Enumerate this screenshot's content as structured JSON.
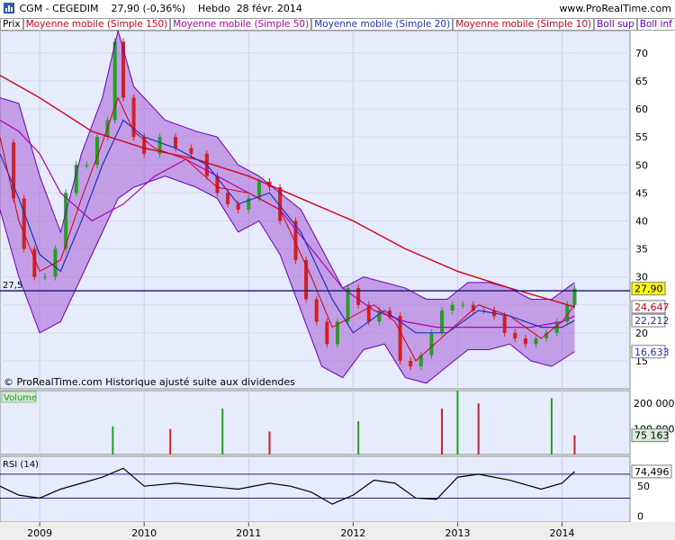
{
  "header": {
    "symbol_title": "CGM - CEGEDIM",
    "price_info": "27,90 (-0,36%)",
    "timeframe": "Hebdo",
    "date": "28 févr. 2014",
    "website": "www.ProRealTime.com"
  },
  "legend": [
    {
      "label": "Prix",
      "color": "#000000"
    },
    {
      "label": "Moyenne mobile (Simple 150)",
      "color": "#d0021b"
    },
    {
      "label": "Moyenne mobile (Simple 50)",
      "color": "#b000b0"
    },
    {
      "label": "Moyenne mobile (Simple 20)",
      "color": "#2030c0"
    },
    {
      "label": "Moyenne mobile (Simple 10)",
      "color": "#d0021b"
    },
    {
      "label": "Boll sup",
      "color": "#6a00c0"
    },
    {
      "label": "Boll inf (20 2)",
      "color": "#6a00c0"
    }
  ],
  "footer_note": "© ProRealTime.com  Historique ajusté suite aux dividendes",
  "hline_label": "27,5",
  "chart_data": [
    {
      "type": "line",
      "panel": "price",
      "title": "CGM - CEGEDIM",
      "x_labels": [
        "2009",
        "2010",
        "2011",
        "2012",
        "2013",
        "2014"
      ],
      "x_label_dates": [
        2009.0,
        2010.0,
        2011.0,
        2012.0,
        2013.0,
        2014.0
      ],
      "xlim": [
        2008.62,
        2014.65
      ],
      "ylim": [
        10,
        74
      ],
      "y_ticks": [
        15,
        20,
        25,
        30,
        35,
        40,
        45,
        50,
        55,
        60,
        65,
        70
      ],
      "horizontal_line": 27.5,
      "price_close": {
        "x": [
          2008.65,
          2008.75,
          2008.85,
          2008.95,
          2009.05,
          2009.15,
          2009.25,
          2009.35,
          2009.45,
          2009.55,
          2009.65,
          2009.72,
          2009.8,
          2009.9,
          2010.0,
          2010.15,
          2010.3,
          2010.45,
          2010.6,
          2010.7,
          2010.8,
          2010.9,
          2011.0,
          2011.1,
          2011.2,
          2011.3,
          2011.45,
          2011.55,
          2011.65,
          2011.75,
          2011.85,
          2011.95,
          2012.05,
          2012.15,
          2012.25,
          2012.35,
          2012.45,
          2012.55,
          2012.65,
          2012.75,
          2012.85,
          2012.95,
          2013.05,
          2013.15,
          2013.25,
          2013.35,
          2013.45,
          2013.55,
          2013.65,
          2013.75,
          2013.85,
          2013.95,
          2014.05,
          2014.12
        ],
        "y": [
          54,
          44,
          35,
          30,
          30,
          35,
          45,
          50,
          50,
          55,
          58,
          72,
          62,
          55,
          52,
          55,
          53,
          52,
          48,
          45,
          43,
          42,
          44,
          47,
          46,
          40,
          33,
          26,
          22,
          18,
          22,
          28,
          25,
          22,
          24,
          23,
          15,
          14,
          16,
          20,
          24,
          25,
          25,
          24,
          24,
          23,
          20,
          19,
          18,
          19,
          20,
          22,
          25,
          27.9
        ]
      },
      "series": [
        {
          "name": "Moyenne mobile (Simple 150)",
          "color": "#d0021b",
          "x": [
            2008.62,
            2009.0,
            2009.5,
            2010.0,
            2010.5,
            2011.0,
            2011.5,
            2012.0,
            2012.5,
            2013.0,
            2013.5,
            2014.12
          ],
          "y": [
            66,
            62,
            56,
            53,
            51,
            48,
            44,
            40,
            35,
            31,
            28,
            24.647
          ]
        },
        {
          "name": "Moyenne mobile (Simple 50)",
          "color": "#b000b0",
          "x": [
            2008.62,
            2008.8,
            2009.0,
            2009.2,
            2009.5,
            2009.8,
            2010.1,
            2010.4,
            2010.7,
            2011.0,
            2011.3,
            2011.6,
            2011.9,
            2012.2,
            2012.5,
            2012.8,
            2013.1,
            2013.4,
            2013.7,
            2014.0,
            2014.12
          ],
          "y": [
            58,
            56,
            52,
            45,
            40,
            43,
            48,
            51,
            48,
            45,
            42,
            35,
            28,
            24,
            22,
            21,
            21,
            21,
            21,
            22,
            23
          ]
        },
        {
          "name": "Moyenne mobile (Simple 20)",
          "color": "#2030c0",
          "x": [
            2008.62,
            2008.8,
            2009.0,
            2009.2,
            2009.4,
            2009.6,
            2009.8,
            2010.0,
            2010.3,
            2010.6,
            2010.9,
            2011.2,
            2011.5,
            2011.8,
            2012.0,
            2012.3,
            2012.6,
            2012.9,
            2013.2,
            2013.5,
            2013.8,
            2014.0,
            2014.12
          ],
          "y": [
            52,
            44,
            34,
            31,
            40,
            50,
            58,
            55,
            53,
            50,
            43,
            45,
            38,
            26,
            20,
            24,
            20,
            20,
            24,
            23,
            21,
            21,
            22.212
          ]
        },
        {
          "name": "Moyenne mobile (Simple 10)",
          "color": "#d0021b",
          "x": [
            2008.62,
            2008.8,
            2009.0,
            2009.2,
            2009.4,
            2009.6,
            2009.75,
            2009.9,
            2010.1,
            2010.4,
            2010.7,
            2011.0,
            2011.3,
            2011.6,
            2011.8,
            2012.0,
            2012.2,
            2012.4,
            2012.6,
            2012.9,
            2013.2,
            2013.5,
            2013.8,
            2014.0,
            2014.12
          ],
          "y": [
            55,
            40,
            31,
            33,
            44,
            54,
            62,
            56,
            53,
            51,
            46,
            45,
            42,
            30,
            21,
            23,
            25,
            22,
            15,
            20,
            25,
            23,
            19,
            22,
            25
          ]
        },
        {
          "name": "Boll sup",
          "color": "#6a00c0",
          "x": [
            2008.62,
            2008.8,
            2009.0,
            2009.2,
            2009.4,
            2009.6,
            2009.75,
            2009.9,
            2010.2,
            2010.5,
            2010.7,
            2010.9,
            2011.1,
            2011.3,
            2011.5,
            2011.7,
            2011.9,
            2012.1,
            2012.3,
            2012.5,
            2012.7,
            2012.9,
            2013.1,
            2013.3,
            2013.5,
            2013.7,
            2013.9,
            2014.12
          ],
          "y": [
            62,
            61,
            48,
            38,
            52,
            62,
            74,
            64,
            58,
            56,
            55,
            50,
            48,
            45,
            42,
            35,
            28,
            30,
            29,
            28,
            26,
            26,
            29,
            29,
            28,
            26,
            26,
            29
          ]
        },
        {
          "name": "Boll inf (20 2)",
          "color": "#6a00c0",
          "x": [
            2008.62,
            2008.8,
            2009.0,
            2009.2,
            2009.4,
            2009.6,
            2009.75,
            2009.9,
            2010.2,
            2010.5,
            2010.7,
            2010.9,
            2011.1,
            2011.3,
            2011.5,
            2011.7,
            2011.9,
            2012.1,
            2012.3,
            2012.5,
            2012.7,
            2012.9,
            2013.1,
            2013.3,
            2013.5,
            2013.7,
            2013.9,
            2014.12
          ],
          "y": [
            42,
            30,
            20,
            22,
            30,
            38,
            44,
            46,
            48,
            46,
            44,
            38,
            40,
            34,
            24,
            14,
            12,
            17,
            18,
            12,
            11,
            14,
            17,
            17,
            18,
            15,
            14,
            16.633
          ]
        }
      ],
      "value_labels": [
        {
          "text": "27,90",
          "value": 27.9,
          "bg": "#ffff00"
        },
        {
          "text": "24,647",
          "value": 24.647,
          "bg": "#ffffff",
          "color": "#d0021b"
        },
        {
          "text": "22,212",
          "value": 22.212,
          "bg": "#ffffff",
          "color": "#2030c0"
        },
        {
          "text": "16,633",
          "value": 16.633,
          "bg": "#ffffff",
          "color": "#2030c0"
        }
      ]
    },
    {
      "type": "bar",
      "panel": "volume",
      "title": "Volume",
      "ylim": [
        0,
        250000
      ],
      "y_ticks": [
        100000,
        200000
      ],
      "y_tick_labels": [
        "100 000",
        "200 000"
      ],
      "current_label": "75 163",
      "x": [
        2009.7,
        2010.25,
        2010.75,
        2011.2,
        2012.05,
        2012.85,
        2013.0,
        2013.2,
        2013.9,
        2014.12
      ],
      "values": [
        110000,
        100000,
        180000,
        90000,
        130000,
        180000,
        250000,
        200000,
        220000,
        75163
      ]
    },
    {
      "type": "line",
      "panel": "rsi",
      "title": "RSI (14)",
      "ylim": [
        -10,
        100
      ],
      "y_ticks": [
        0,
        50
      ],
      "levels": [
        70,
        30
      ],
      "current_label": "74,496",
      "x": [
        2008.62,
        2008.8,
        2009.0,
        2009.2,
        2009.4,
        2009.6,
        2009.8,
        2010.0,
        2010.3,
        2010.6,
        2010.9,
        2011.2,
        2011.4,
        2011.6,
        2011.8,
        2012.0,
        2012.2,
        2012.4,
        2012.6,
        2012.8,
        2013.0,
        2013.2,
        2013.5,
        2013.8,
        2014.0,
        2014.12
      ],
      "y": [
        50,
        35,
        30,
        45,
        55,
        65,
        80,
        50,
        55,
        50,
        45,
        55,
        50,
        40,
        20,
        35,
        60,
        55,
        30,
        28,
        65,
        70,
        60,
        45,
        55,
        74.496
      ]
    }
  ],
  "colors": {
    "panel_bg": "#e6ecfb",
    "band_fill": "#a55fd6",
    "up_candle": "#22a022",
    "down_candle": "#d02020",
    "hline": "#202080"
  }
}
